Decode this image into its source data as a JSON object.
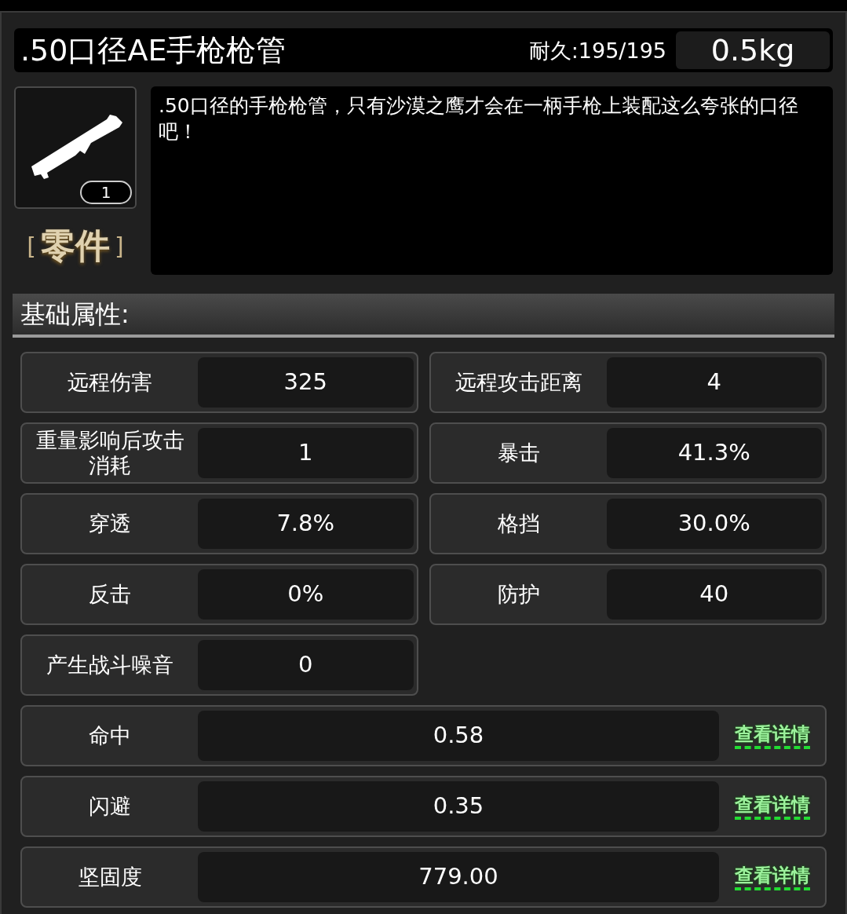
{
  "item": {
    "name": ".50口径AE手枪枪管",
    "durability": "耐久:195/195",
    "weight": "0.5kg",
    "count": "1",
    "category_open": "[",
    "category": "零件",
    "category_close": "]",
    "description": ".50口径的手枪枪管，只有沙漠之鹰才会在一柄手枪上装配这么夸张的口径吧！"
  },
  "section_title": "基础属性:",
  "stats": [
    {
      "label": "远程伤害",
      "value": "325"
    },
    {
      "label": "远程攻击距离",
      "value": "4"
    },
    {
      "label": "重量影响后攻击消耗",
      "value": "1"
    },
    {
      "label": "暴击",
      "value": "41.3%"
    },
    {
      "label": "穿透",
      "value": "7.8%"
    },
    {
      "label": "格挡",
      "value": "30.0%"
    },
    {
      "label": "反击",
      "value": "0%"
    },
    {
      "label": "防护",
      "value": "40"
    },
    {
      "label": "产生战斗噪音",
      "value": "0"
    }
  ],
  "wide_stats": [
    {
      "label": "命中",
      "value": "0.58",
      "link": "查看详情"
    },
    {
      "label": "闪避",
      "value": "0.35",
      "link": "查看详情"
    },
    {
      "label": "坚固度",
      "value": "779.00",
      "link": "查看详情"
    }
  ]
}
